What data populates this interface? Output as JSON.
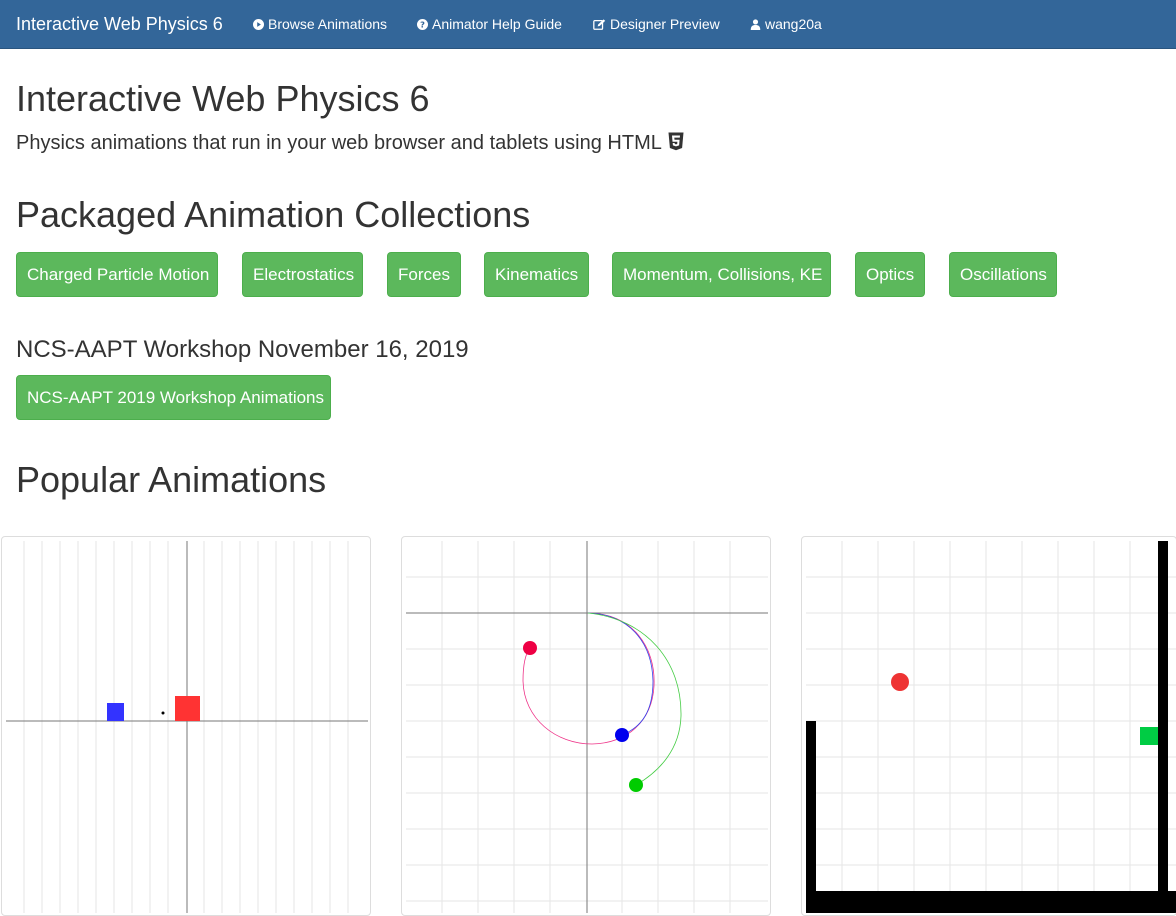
{
  "navbar": {
    "brand": "Interactive Web Physics 6",
    "links": [
      {
        "label": "Browse Animations",
        "icon": "play-circle-icon"
      },
      {
        "label": "Animator Help Guide",
        "icon": "question-circle-icon"
      },
      {
        "label": "Designer Preview",
        "icon": "edit-icon"
      },
      {
        "label": "wang20a",
        "icon": "user-icon"
      }
    ]
  },
  "header": {
    "title": "Interactive Web Physics 6",
    "lead": "Physics animations that run in your web browser and tablets using HTML",
    "lead_icon": "html5-icon"
  },
  "collections": {
    "heading": "Packaged Animation Collections",
    "buttons": [
      "Charged Particle Motion",
      "Electrostatics",
      "Forces",
      "Kinematics",
      "Momentum, Collisions, KE",
      "Optics",
      "Oscillations"
    ]
  },
  "workshop": {
    "heading": "NCS-AAPT Workshop November 16, 2019",
    "button": "NCS-AAPT 2019 Workshop Animations"
  },
  "popular": {
    "heading": "Popular Animations",
    "thumbnails": [
      {
        "name": "collision-animation",
        "colors": [
          "#3333ff",
          "#ff3333",
          "#000000"
        ]
      },
      {
        "name": "circular-motion-animation",
        "colors": [
          "#ee0044",
          "#0000ee",
          "#00cc00"
        ]
      },
      {
        "name": "projectile-box-animation",
        "colors": [
          "#ee3333",
          "#00cc44",
          "#000000"
        ]
      }
    ]
  },
  "colors": {
    "navbar": "#336699",
    "button": "#5cb85c",
    "button_border": "#4cae4c",
    "text": "#333333"
  }
}
